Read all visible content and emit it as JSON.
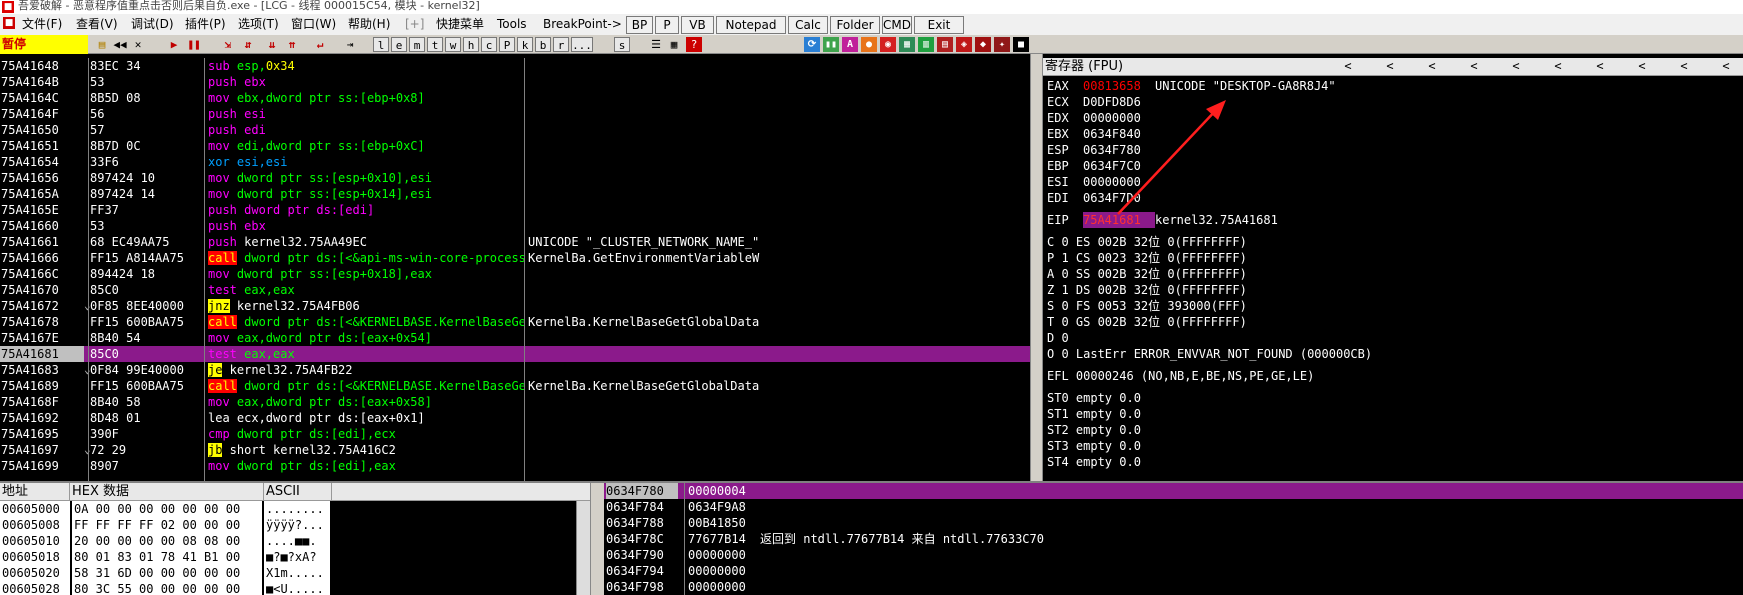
{
  "titlebar": {
    "text": "吾爱破解 - 恶意程序值重点击否则后果自负.exe - [LCG - 线程 000015C54, 模块 - kernel32]"
  },
  "menu": {
    "items": [
      "文件(F)",
      "查看(V)",
      "调试(D)",
      "插件(P)",
      "选项(T)",
      "窗口(W)",
      "帮助(H)",
      "[+]",
      "快捷菜单",
      "Tools",
      "BreakPoint->"
    ],
    "quick": [
      "BP",
      "P",
      "VB",
      "Notepad",
      "Calc",
      "Folder",
      "CMD",
      "Exit"
    ]
  },
  "toolbar": {
    "status": "暂停",
    "letters": [
      "l",
      "e",
      "m",
      "t",
      "w",
      "h",
      "c",
      "P",
      "k",
      "b",
      "r",
      "...",
      "s"
    ]
  },
  "disasm": [
    {
      "addr": "75A41648",
      "mark": "",
      "hex": "83EC 34",
      "ins": [
        [
          "t",
          "sub esp,"
        ],
        [
          "y",
          "0x34"
        ]
      ],
      "cmt": ""
    },
    {
      "addr": "75A4164B",
      "mark": "",
      "hex": "53",
      "ins": [
        [
          "m",
          "push ebx"
        ]
      ],
      "cmt": ""
    },
    {
      "addr": "75A4164C",
      "mark": "",
      "hex": "8B5D 08",
      "ins": [
        [
          "t",
          "mov ebx,dword ptr ss:[ebp+0x8]"
        ]
      ],
      "cmt": ""
    },
    {
      "addr": "75A4164F",
      "mark": "",
      "hex": "56",
      "ins": [
        [
          "m",
          "push esi"
        ]
      ],
      "cmt": ""
    },
    {
      "addr": "75A41650",
      "mark": "",
      "hex": "57",
      "ins": [
        [
          "m",
          "push edi"
        ]
      ],
      "cmt": ""
    },
    {
      "addr": "75A41651",
      "mark": "",
      "hex": "8B7D 0C",
      "ins": [
        [
          "t",
          "mov edi,dword ptr ss:[ebp+0xC]"
        ]
      ],
      "cmt": ""
    },
    {
      "addr": "75A41654",
      "mark": "",
      "hex": "33F6",
      "ins": [
        [
          "b",
          "xor esi,esi"
        ]
      ],
      "cmt": ""
    },
    {
      "addr": "75A41656",
      "mark": "",
      "hex": "897424 10",
      "ins": [
        [
          "t",
          "mov dword ptr ss:[esp+0x10],esi"
        ]
      ],
      "cmt": ""
    },
    {
      "addr": "75A4165A",
      "mark": "",
      "hex": "897424 14",
      "ins": [
        [
          "t",
          "mov dword ptr ss:[esp+0x14],esi"
        ]
      ],
      "cmt": ""
    },
    {
      "addr": "75A4165E",
      "mark": "",
      "hex": "FF37",
      "ins": [
        [
          "m",
          "push dword ptr ds:[edi]"
        ]
      ],
      "cmt": ""
    },
    {
      "addr": "75A41660",
      "mark": "",
      "hex": "53",
      "ins": [
        [
          "m",
          "push ebx"
        ]
      ],
      "cmt": ""
    },
    {
      "addr": "75A41661",
      "mark": "",
      "hex": "68 EC49AA75",
      "ins": [
        [
          "m",
          "push "
        ],
        [
          "w",
          "kernel32.75AA49EC"
        ]
      ],
      "cmt": "UNICODE \"_CLUSTER_NETWORK_NAME_\""
    },
    {
      "addr": "75A41666",
      "mark": "",
      "hex": "FF15 A814AA75",
      "ins": [
        [
          "r",
          "call"
        ],
        [
          "t",
          " dword ptr ds:[<&api-ms-win-core-processenvironment"
        ]
      ],
      "cmt": "KernelBa.GetEnvironmentVariableW"
    },
    {
      "addr": "75A4166C",
      "mark": "",
      "hex": "894424 18",
      "ins": [
        [
          "t",
          "mov dword ptr ss:[esp+0x18],eax"
        ]
      ],
      "cmt": ""
    },
    {
      "addr": "75A41670",
      "mark": "",
      "hex": "85C0",
      "ins": [
        [
          "t",
          "test eax,eax"
        ]
      ],
      "cmt": ""
    },
    {
      "addr": "75A41672",
      "mark": "⌄",
      "hex": "0F85 8EE40000",
      "ins": [
        [
          "yb",
          "jnz"
        ],
        [
          "w",
          " kernel32.75A4FB06"
        ]
      ],
      "cmt": ""
    },
    {
      "addr": "75A41678",
      "mark": "",
      "hex": "FF15 600BAA75",
      "ins": [
        [
          "r",
          "call"
        ],
        [
          "t",
          " dword ptr ds:[<&KERNELBASE.KernelBaseGetGlobal"
        ]
      ],
      "cmt": "KernelBa.KernelBaseGetGlobalData"
    },
    {
      "addr": "75A4167E",
      "mark": "",
      "hex": "8B40 54",
      "ins": [
        [
          "t",
          "mov eax,dword ptr ds:[eax+0x54]"
        ]
      ],
      "cmt": ""
    },
    {
      "addr": "75A41681",
      "mark": "",
      "hex": "85C0",
      "ins": [
        [
          "t",
          "test eax,eax"
        ]
      ],
      "cmt": "",
      "sel": true
    },
    {
      "addr": "75A41683",
      "mark": "⌄",
      "hex": "0F84 99E40000",
      "ins": [
        [
          "yb",
          "je"
        ],
        [
          "w",
          " kernel32.75A4FB22"
        ]
      ],
      "cmt": ""
    },
    {
      "addr": "75A41689",
      "mark": "",
      "hex": "FF15 600BAA75",
      "ins": [
        [
          "r",
          "call"
        ],
        [
          "t",
          " dword ptr ds:[<&KERNELBASE.KernelBaseGetGlobal"
        ]
      ],
      "cmt": "KernelBa.KernelBaseGetGlobalData"
    },
    {
      "addr": "75A4168F",
      "mark": "",
      "hex": "8B40 58",
      "ins": [
        [
          "t",
          "mov eax,dword ptr ds:[eax+0x58]"
        ]
      ],
      "cmt": ""
    },
    {
      "addr": "75A41692",
      "mark": "",
      "hex": "8D48 01",
      "ins": [
        [
          "w",
          "lea ecx,dword ptr ds:[eax+0x1]"
        ]
      ],
      "cmt": ""
    },
    {
      "addr": "75A41695",
      "mark": "",
      "hex": "390F",
      "ins": [
        [
          "t",
          "cmp dword ptr ds:[edi],ecx"
        ]
      ],
      "cmt": ""
    },
    {
      "addr": "75A41697",
      "mark": "⌄",
      "hex": "72 29",
      "ins": [
        [
          "yb",
          "jb"
        ],
        [
          "w",
          " short kernel32.75A416C2"
        ]
      ],
      "cmt": ""
    },
    {
      "addr": "75A41699",
      "mark": "",
      "hex": "8907",
      "ins": [
        [
          "t",
          "mov dword ptr ds:[edi],eax"
        ]
      ],
      "cmt": ""
    }
  ],
  "registers": {
    "title": "寄存器 (FPU)",
    "gp": [
      {
        "name": "EAX",
        "value": "00813658",
        "style": "red",
        "comment": "UNICODE \"DESKTOP-GA8R8J4\""
      },
      {
        "name": "ECX",
        "value": "D0DFD8D6",
        "style": "",
        "comment": ""
      },
      {
        "name": "EDX",
        "value": "00000000",
        "style": "",
        "comment": ""
      },
      {
        "name": "EBX",
        "value": "0634F840",
        "style": "",
        "comment": ""
      },
      {
        "name": "ESP",
        "value": "0634F780",
        "style": "",
        "comment": ""
      },
      {
        "name": "EBP",
        "value": "0634F7C0",
        "style": "",
        "comment": ""
      },
      {
        "name": "ESI",
        "value": "00000000",
        "style": "",
        "comment": ""
      },
      {
        "name": "EDI",
        "value": "0634F7D0",
        "style": "",
        "comment": ""
      }
    ],
    "eip": {
      "name": "EIP",
      "value": "75A41681",
      "comment": "kernel32.75A41681"
    },
    "flags": [
      "C 0  ES 002B 32位 0(FFFFFFFF)",
      "P 1  CS 0023 32位 0(FFFFFFFF)",
      "A 0  SS 002B 32位 0(FFFFFFFF)",
      "Z 1  DS 002B 32位 0(FFFFFFFF)",
      "S 0  FS 0053 32位 393000(FFF)",
      "T 0  GS 002B 32位 0(FFFFFFFF)",
      "D 0",
      "O 0  LastErr ERROR_ENVVAR_NOT_FOUND (000000CB)"
    ],
    "efl": "EFL 00000246 (NO,NB,E,BE,NS,PE,GE,LE)",
    "fpu": [
      "ST0 empty 0.0",
      "ST1 empty 0.0",
      "ST2 empty 0.0",
      "ST3 empty 0.0",
      "ST4 empty 0.0"
    ]
  },
  "dump": {
    "headers": [
      "地址",
      "HEX 数据",
      "ASCII"
    ],
    "rows": [
      {
        "addr": "00605000",
        "hex": "0A 00 00 00 00 00 00 00",
        "ascii": "........"
      },
      {
        "addr": "00605008",
        "hex": "FF FF FF FF 02 00 00 00",
        "ascii": "ÿÿÿÿ?..."
      },
      {
        "addr": "00605010",
        "hex": "20 00 00 00 00 08 08 00",
        " ascii": "",
        "ascii": " ....■■."
      },
      {
        "addr": "00605018",
        "hex": "80 01 83 01 78 41 B1 00",
        "ascii": "■?■?xA?"
      },
      {
        "addr": "00605020",
        "hex": "58 31 6D 00 00 00 00 00",
        "ascii": "X1m....."
      },
      {
        "addr": "00605028",
        "hex": "80 3C 55 00 00 00 00 00",
        "ascii": "■<U....."
      }
    ]
  },
  "stack": [
    {
      "addr": "0634F780",
      "value": "00000004",
      "comment": "",
      "sel": true
    },
    {
      "addr": "0634F784",
      "value": "0634F9A8",
      "comment": ""
    },
    {
      "addr": "0634F788",
      "value": "00B41850",
      "comment": ""
    },
    {
      "addr": "0634F78C",
      "value": "77677B14",
      "comment": "返回到 ntdll.77677B14 来自 ntdll.77633C70"
    },
    {
      "addr": "0634F790",
      "value": "00000000",
      "comment": ""
    },
    {
      "addr": "0634F794",
      "value": "00000000",
      "comment": ""
    },
    {
      "addr": "0634F798",
      "value": "00000000",
      "comment": ""
    }
  ],
  "colors": {
    "selection": "#8b1a8b",
    "accent_red": "#ff0000",
    "pause_bg": "#ffff00"
  }
}
